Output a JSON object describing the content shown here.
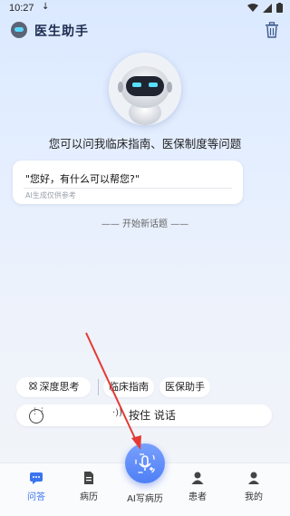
{
  "status": {
    "time": "10:27",
    "notif": "↓",
    "battery_icon": "battery-icon"
  },
  "header": {
    "title": "医生助手"
  },
  "intro": {
    "text": "您可以问我临床指南、医保制度等问题"
  },
  "bubble": {
    "message": "\"您好，有什么可以帮您?\"",
    "note": "AI生成仅供参考"
  },
  "divider": {
    "text": "—— 开始新话题 ——"
  },
  "chips": [
    {
      "label": "深度思考"
    },
    {
      "label": "临床指南"
    },
    {
      "label": "医保助手"
    }
  ],
  "input": {
    "voice_label": "按住 说话",
    "voice_glyph": "·))"
  },
  "tabs": [
    {
      "label": "问答"
    },
    {
      "label": "病历"
    },
    {
      "label": "AI写病历"
    },
    {
      "label": "患者"
    },
    {
      "label": "我的"
    }
  ],
  "colors": {
    "accent": "#3a74f0",
    "arrow": "#e53935"
  }
}
